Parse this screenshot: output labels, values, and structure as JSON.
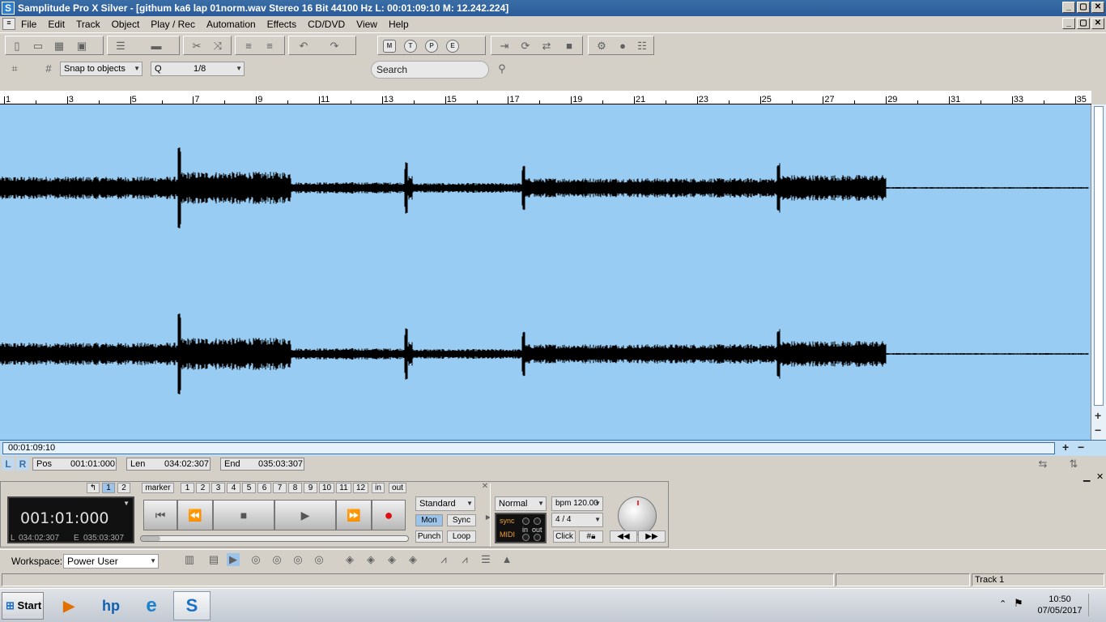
{
  "window": {
    "title": "Samplitude Pro X Silver - [githum ka6 lap 01norm.wav  Stereo 16 Bit 44100 Hz L: 00:01:09:10 M: 12.242.224]",
    "app_icon": "S",
    "min": "_",
    "max": "▢",
    "close": "✕"
  },
  "menu": [
    "File",
    "Edit",
    "Track",
    "Object",
    "Play / Rec",
    "Automation",
    "Effects",
    "CD/DVD",
    "View",
    "Help"
  ],
  "toolbar": {
    "mode_letters": [
      "M",
      "T",
      "P",
      "E"
    ],
    "snap_label": "Snap to objects",
    "quantize_label": "Q",
    "quantize_value": "1/8",
    "search_placeholder": "Search"
  },
  "ruler": {
    "labels": [
      "1",
      "3",
      "5",
      "7",
      "9",
      "11",
      "13",
      "15",
      "17",
      "19",
      "21",
      "23",
      "25",
      "27",
      "29",
      "31",
      "33",
      "35"
    ]
  },
  "position_field": "00:01:09:10",
  "range": {
    "left_marker": "L",
    "right_marker": "R",
    "pos_label": "Pos",
    "pos_value": "001:01:000",
    "len_label": "Len",
    "len_value": "034:02:307",
    "end_label": "End",
    "end_value": "035:03:307"
  },
  "transport": {
    "numbers_left": [
      "1",
      "2"
    ],
    "marker_label": "marker",
    "marker_numbers": [
      "1",
      "2",
      "3",
      "4",
      "5",
      "6",
      "7",
      "8",
      "9",
      "10",
      "11",
      "12"
    ],
    "in_label": "in",
    "out_label": "out",
    "time": "001:01:000",
    "time_l": "L",
    "time_l_value": "034:02:307",
    "time_e": "E",
    "time_e_value": "035:03:307",
    "mode_select": "Standard",
    "mon": "Mon",
    "sync": "Sync",
    "punch": "Punch",
    "loop": "Loop",
    "normal_select": "Normal",
    "bpm": "bpm 120.00",
    "signature": "4 / 4",
    "click": "Click",
    "sync_label": "sync",
    "midi_label": "MIDI",
    "in": "in",
    "out": "out"
  },
  "workspace": {
    "label": "Workspace:",
    "value": "Power User"
  },
  "status": {
    "track": "Track 1"
  },
  "taskbar": {
    "start": "Start",
    "time": "10:50",
    "date": "07/05/2017"
  },
  "colors": {
    "track_bg": "#99ccf2",
    "titlebar": "#3a6ea5",
    "record": "#e01010"
  }
}
